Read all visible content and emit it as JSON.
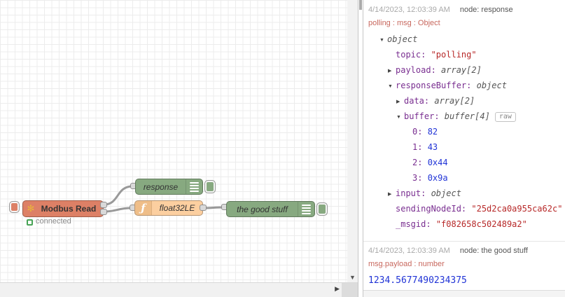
{
  "canvas": {
    "nodes": {
      "modbus": {
        "label": "Modbus Read",
        "icon": "✻"
      },
      "response": {
        "label": "response"
      },
      "float32": {
        "label": "float32LE",
        "icon": "ƒ"
      },
      "goodstuff": {
        "label": "the good stuff"
      }
    },
    "status": {
      "label": "connected"
    }
  },
  "icons": {
    "scroll_down": "▼",
    "scroll_right": "▶",
    "collapse": "▼",
    "expand": "▶"
  },
  "debug_panel": {
    "messages": [
      {
        "timestamp": "4/14/2023, 12:03:39 AM",
        "source": "node: response",
        "path": "polling : msg : Object",
        "tree": [
          {
            "indent": 0,
            "arrow": "down",
            "value": "object",
            "vtype": "type"
          },
          {
            "indent": 1,
            "key": "topic",
            "value": "\"polling\"",
            "vtype": "string"
          },
          {
            "indent": 1,
            "arrow": "right",
            "key": "payload",
            "value": "array[2]",
            "vtype": "type"
          },
          {
            "indent": 1,
            "arrow": "down",
            "key": "responseBuffer",
            "value": "object",
            "vtype": "type"
          },
          {
            "indent": 2,
            "arrow": "right",
            "key": "data",
            "value": "array[2]",
            "vtype": "type"
          },
          {
            "indent": 2,
            "arrow": "down",
            "key": "buffer",
            "value": "buffer[4]",
            "vtype": "type",
            "badge": "raw"
          },
          {
            "indent": 3,
            "key": "0",
            "value": "82",
            "vtype": "number"
          },
          {
            "indent": 3,
            "key": "1",
            "value": "43",
            "vtype": "number"
          },
          {
            "indent": 3,
            "key": "2",
            "value": "0x44",
            "vtype": "number"
          },
          {
            "indent": 3,
            "key": "3",
            "value": "0x9a",
            "vtype": "number"
          },
          {
            "indent": 1,
            "arrow": "right",
            "key": "input",
            "value": "object",
            "vtype": "type"
          },
          {
            "indent": 1,
            "key": "sendingNodeId",
            "value": "\"25d2ca0a955ca62c\"",
            "vtype": "string"
          },
          {
            "indent": 1,
            "key": "_msgid",
            "value": "\"f082658c502489a2\"",
            "vtype": "string"
          }
        ]
      },
      {
        "timestamp": "4/14/2023, 12:03:39 AM",
        "source": "node: the good stuff",
        "path": "msg.payload : number",
        "value": "1234.5677490234375"
      }
    ]
  },
  "colors": {
    "modbus_node": "#dd8066",
    "debug_node": "#87a980",
    "function_node": "#fccfa0",
    "status_green": "#47a355",
    "gold_icon": "#e8b33c",
    "wire_gray": "#999999",
    "key_purple": "#792e90",
    "string_red": "#b72828",
    "number_blue": "#2033d6",
    "meta_path_red": "#c8685e"
  }
}
